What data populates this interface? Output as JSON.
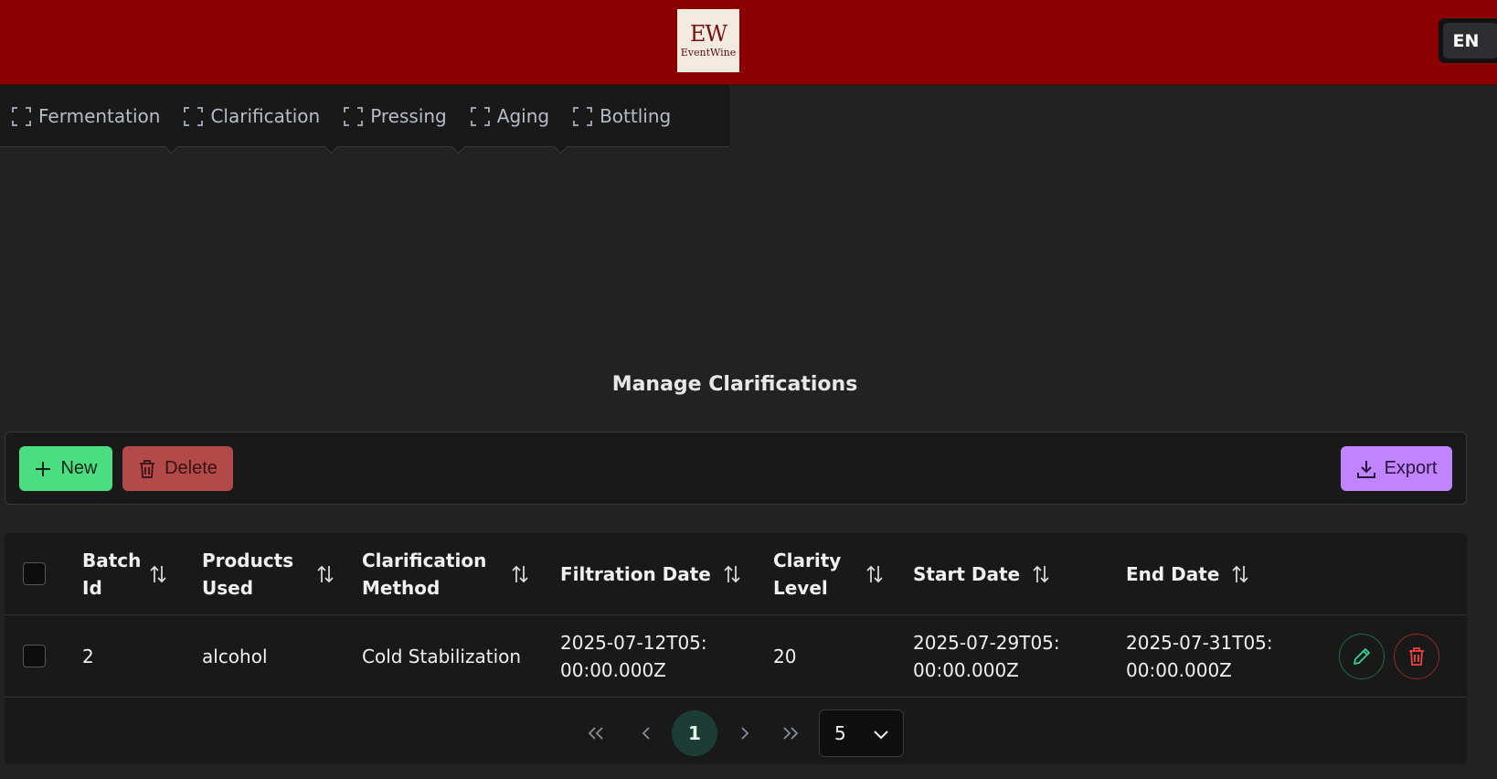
{
  "header": {
    "logo_mark": "EW",
    "logo_word": "EventWine",
    "language": "EN"
  },
  "tabs": [
    {
      "label": "Fermentation"
    },
    {
      "label": "Clarification"
    },
    {
      "label": "Pressing"
    },
    {
      "label": "Aging"
    },
    {
      "label": "Bottling"
    }
  ],
  "page": {
    "title": "Manage Clarifications"
  },
  "toolbar": {
    "new_label": "New",
    "delete_label": "Delete",
    "export_label": "Export"
  },
  "table": {
    "columns": [
      {
        "label": "Batch Id"
      },
      {
        "label": "Products Used"
      },
      {
        "label": "Clarification Method"
      },
      {
        "label": "Filtration Date"
      },
      {
        "label": "Clarity Level"
      },
      {
        "label": "Start Date"
      },
      {
        "label": "End Date"
      }
    ],
    "rows": [
      {
        "batch_id": "2",
        "products_used": "alcohol",
        "method": "Cold Stabilization",
        "filtration_date": "2025-07-12T05:00:00.000Z",
        "clarity_level": "20",
        "start_date": "2025-07-29T05:00:00.000Z",
        "end_date": "2025-07-31T05:00:00.000Z"
      }
    ]
  },
  "pagination": {
    "current_page": "1",
    "rows_per_page": "5"
  },
  "colors": {
    "header_bg": "#8b0000",
    "new_button": "#4ade80",
    "delete_button": "#b34a4a",
    "export_button": "#c084fc",
    "current_page_bg": "#1d3d34"
  },
  "icons": {
    "tab_icon": "frame-corners-icon",
    "new": "plus-icon",
    "delete": "trash-icon",
    "export": "download-icon",
    "sort": "sort-arrows-icon",
    "edit": "pencil-icon",
    "row_delete": "trash-icon"
  }
}
